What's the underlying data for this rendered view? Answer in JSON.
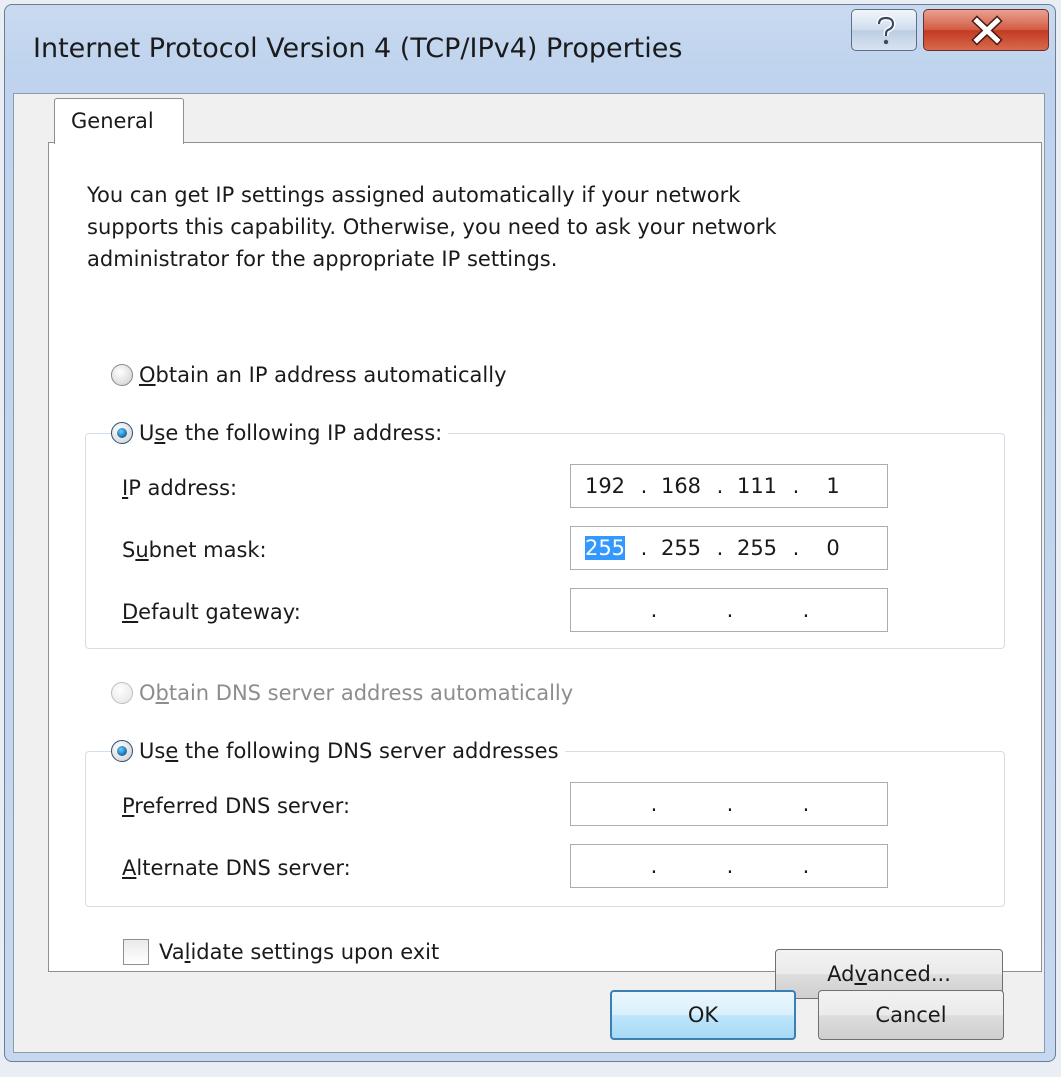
{
  "window": {
    "title": "Internet Protocol Version 4 (TCP/IPv4) Properties",
    "help_icon": "question-mark-icon",
    "close_icon": "close-x-icon"
  },
  "tabs": [
    {
      "label": "General",
      "selected": true
    }
  ],
  "intro_text": "You can get IP settings assigned automatically if your network\nsupports this capability. Otherwise, you need to ask your network\nadministrator for the appropriate IP settings.",
  "ip_mode": {
    "auto": {
      "access": "O",
      "rest": "btain an IP address automatically",
      "checked": false
    },
    "manual": {
      "pre": "U",
      "access": "s",
      "rest": "e the following IP address:",
      "checked": true
    }
  },
  "ip_fields": {
    "ip_address": {
      "access": "I",
      "rest": "P address:",
      "octets": [
        "192",
        "168",
        "111",
        "1"
      ]
    },
    "subnet_mask": {
      "pre": "S",
      "access": "u",
      "rest": "bnet mask:",
      "octets": [
        "255",
        "255",
        "255",
        "0"
      ],
      "selected_octet": 0
    },
    "default_gateway": {
      "access": "D",
      "rest": "efault gateway:",
      "octets": [
        "",
        "",
        "",
        ""
      ]
    }
  },
  "dns_mode": {
    "auto": {
      "pre": "O",
      "access": "b",
      "rest": "tain DNS server address automatically",
      "checked": false,
      "disabled": true
    },
    "manual": {
      "pre": "Us",
      "access": "e",
      "rest": " the following DNS server addresses",
      "checked": true
    }
  },
  "dns_fields": {
    "preferred": {
      "access": "P",
      "rest": "referred DNS server:",
      "octets": [
        "",
        "",
        "",
        ""
      ]
    },
    "alternate": {
      "access": "A",
      "rest": "lternate DNS server:",
      "octets": [
        "",
        "",
        "",
        ""
      ]
    }
  },
  "validate": {
    "pre": "Va",
    "access": "l",
    "rest": "idate settings upon exit",
    "checked": false
  },
  "buttons": {
    "advanced": {
      "pre": "Ad",
      "access": "v",
      "rest": "anced..."
    },
    "ok": "OK",
    "cancel": "Cancel"
  },
  "colors": {
    "selection": "#3399ff",
    "default_button_border": "#3c7fb1",
    "close_button": "#c23a22"
  }
}
